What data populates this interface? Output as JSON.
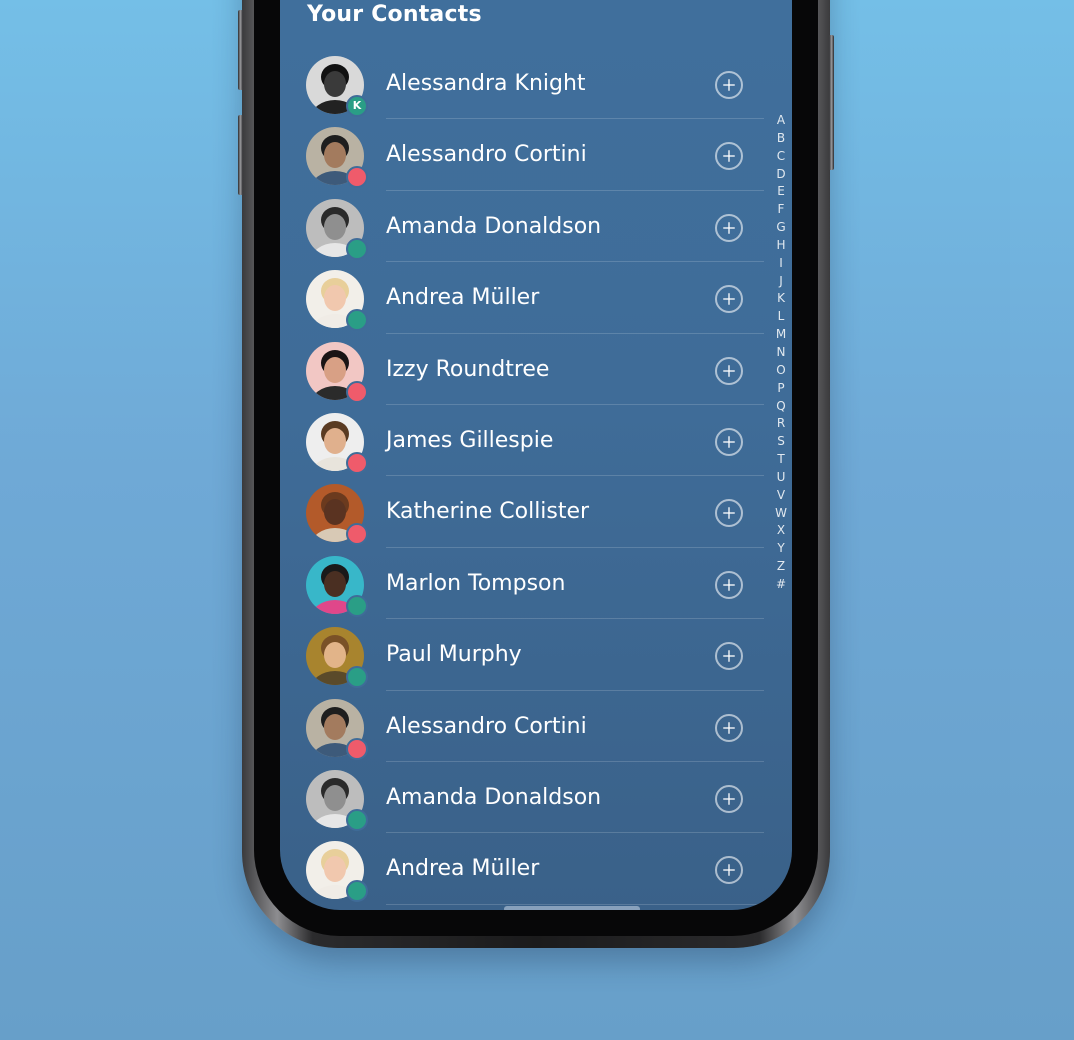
{
  "screen": {
    "section_title": "Your Contacts"
  },
  "contacts": [
    {
      "name": "Alessandra Knight",
      "status": "app",
      "badge_label": "K",
      "avatar": {
        "bg": "#d9d9d9",
        "skin": "#3a3a3a",
        "hair": "#111111",
        "shirt": "#222222"
      }
    },
    {
      "name": "Alessandro Cortini",
      "status": "offline",
      "avatar": {
        "bg": "#b9b2a3",
        "skin": "#a37b5e",
        "hair": "#1e1e1e",
        "shirt": "#3d5a7a"
      }
    },
    {
      "name": "Amanda Donaldson",
      "status": "online",
      "avatar": {
        "bg": "#bdbdbd",
        "skin": "#8f8f8f",
        "hair": "#2a2a2a",
        "shirt": "#e6e6e6"
      }
    },
    {
      "name": "Andrea Müller",
      "status": "online",
      "avatar": {
        "bg": "#f2efe9",
        "skin": "#f1c8ae",
        "hair": "#e8cf9a",
        "shirt": "#f0ece6"
      }
    },
    {
      "name": "Izzy Roundtree",
      "status": "offline",
      "avatar": {
        "bg": "#f2c7c4",
        "skin": "#d8a085",
        "hair": "#1a1414",
        "shirt": "#2b2b2b"
      }
    },
    {
      "name": "James Gillespie",
      "status": "offline",
      "avatar": {
        "bg": "#eeeeee",
        "skin": "#e0b08d",
        "hair": "#5a3b22",
        "shirt": "#e8e4dc"
      }
    },
    {
      "name": "Katherine Collister",
      "status": "offline",
      "avatar": {
        "bg": "#b35a2a",
        "skin": "#5a3321",
        "hair": "#6b3a1e",
        "shirt": "#d8c9b5"
      }
    },
    {
      "name": "Marlon Tompson",
      "status": "online",
      "avatar": {
        "bg": "#38b7c9",
        "skin": "#4a2f22",
        "hair": "#1a1a1a",
        "shirt": "#e0478a"
      }
    },
    {
      "name": "Paul Murphy",
      "status": "online",
      "avatar": {
        "bg": "#a8842e",
        "skin": "#e2b489",
        "hair": "#7a5127",
        "shirt": "#5a4a2a"
      }
    },
    {
      "name": "Alessandro Cortini",
      "status": "offline",
      "avatar": {
        "bg": "#b9b2a3",
        "skin": "#a37b5e",
        "hair": "#1e1e1e",
        "shirt": "#3d5a7a"
      }
    },
    {
      "name": "Amanda Donaldson",
      "status": "online",
      "avatar": {
        "bg": "#bdbdbd",
        "skin": "#8f8f8f",
        "hair": "#2a2a2a",
        "shirt": "#e6e6e6"
      }
    },
    {
      "name": "Andrea Müller",
      "status": "online",
      "avatar": {
        "bg": "#f2efe9",
        "skin": "#f1c8ae",
        "hair": "#e8cf9a",
        "shirt": "#f0ece6"
      }
    }
  ],
  "alphabet_index": [
    "A",
    "B",
    "C",
    "D",
    "E",
    "F",
    "G",
    "H",
    "I",
    "J",
    "K",
    "L",
    "M",
    "N",
    "O",
    "P",
    "Q",
    "R",
    "S",
    "T",
    "U",
    "V",
    "W",
    "X",
    "Y",
    "Z",
    "#"
  ],
  "icons": {
    "add": "plus-circle-icon"
  },
  "colors": {
    "online": "#2a9e86",
    "offline": "#ef5b6b",
    "screen_bg": "#3f6c98",
    "page_bg": "#6fa9d6"
  }
}
